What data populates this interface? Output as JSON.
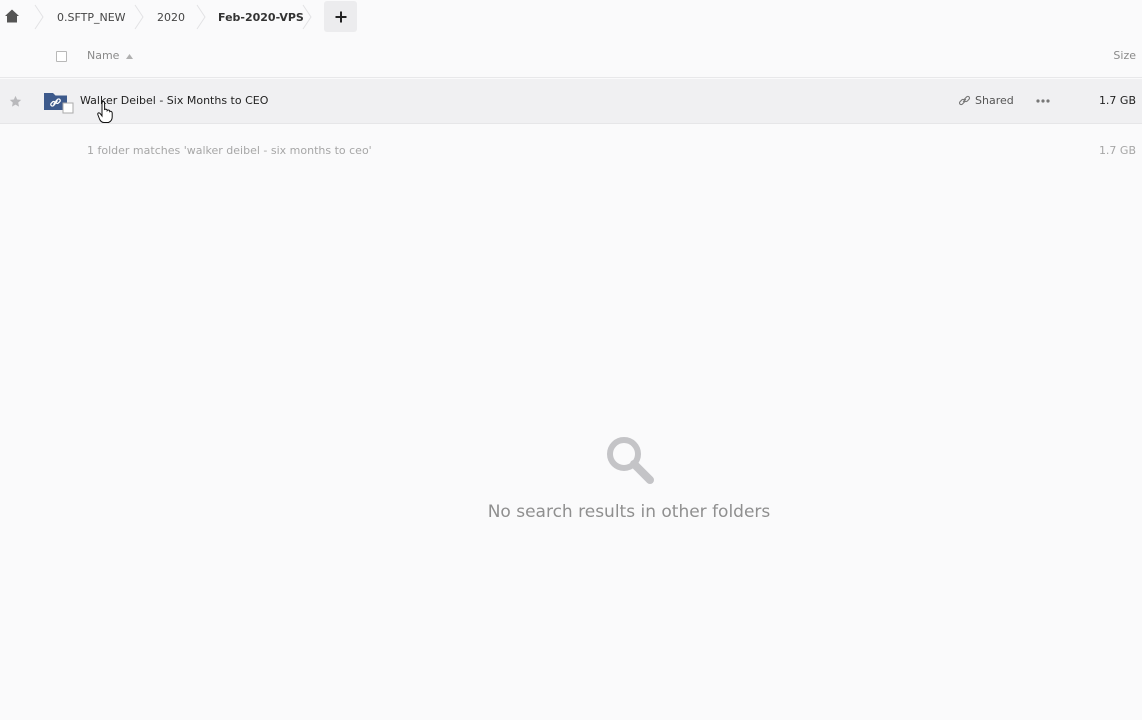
{
  "breadcrumb": {
    "items": [
      {
        "label": "0.SFTP_NEW"
      },
      {
        "label": "2020"
      },
      {
        "label": "Feb-2020-VPS"
      }
    ],
    "add_label": "+"
  },
  "list_header": {
    "name_label": "Name",
    "size_label": "Size"
  },
  "file": {
    "name": "Walker Deibel - Six Months to CEO",
    "shared_label": "Shared",
    "size": "1.7 GB"
  },
  "summary": {
    "text": "1 folder matches 'walker deibel - six months to ceo'",
    "size": "1.7 GB"
  },
  "empty_state": {
    "text": "No search results in other folders"
  },
  "colors": {
    "folder": "#3d5a8c",
    "background": "#fafafb",
    "row_hover": "#f0f0f2"
  },
  "icons": [
    "home-icon",
    "plus-icon",
    "sort-ascending-icon",
    "star-icon",
    "shared-folder-icon",
    "link-icon",
    "more-icon",
    "search-icon",
    "hand-cursor-icon"
  ]
}
